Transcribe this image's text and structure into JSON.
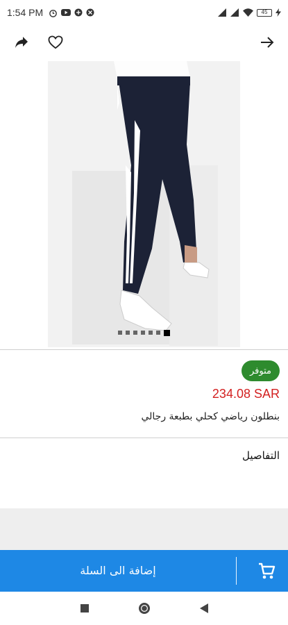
{
  "status_bar": {
    "time": "1:54 PM",
    "battery": "45",
    "icons": [
      "alarm-icon",
      "youtube-icon",
      "app-icon",
      "app-icon",
      "signal-icon",
      "signal-icon",
      "wifi-icon",
      "charging-icon"
    ]
  },
  "product": {
    "availability": "متوفر",
    "price": "234.08 SAR",
    "name": "بنطلون رياضي كحلي بطبعة رجالي",
    "image_count": 7,
    "active_image": 7
  },
  "details": {
    "label": "التفاصيل"
  },
  "cart": {
    "label": "إضافة الى السلة"
  },
  "colors": {
    "accent": "#1e88e5",
    "badge": "#2e8b2e",
    "price": "#d32020"
  }
}
